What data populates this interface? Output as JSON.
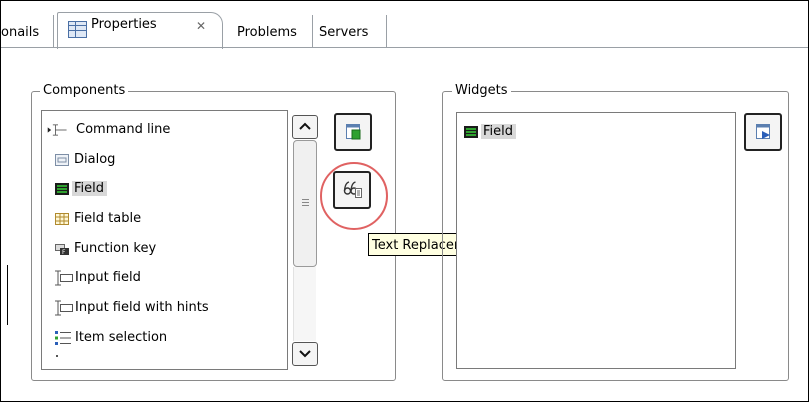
{
  "tabs": {
    "partial_left_label": "onails",
    "active_label": "Properties",
    "close_glyph": "✕",
    "problems_label": "Problems",
    "servers_label": "Servers"
  },
  "components": {
    "group_label": "Components",
    "items": [
      {
        "label": "Command line",
        "icon": "command-line-icon"
      },
      {
        "label": "Dialog",
        "icon": "dialog-icon"
      },
      {
        "label": "Field",
        "icon": "field-icon",
        "selected": true
      },
      {
        "label": "Field table",
        "icon": "field-table-icon"
      },
      {
        "label": "Function key",
        "icon": "function-key-icon"
      },
      {
        "label": "Input field",
        "icon": "input-field-icon"
      },
      {
        "label": "Input field with hints",
        "icon": "input-field-hints-icon"
      },
      {
        "label": "Item selection",
        "icon": "item-selection-icon"
      }
    ],
    "add_button_icon": "add-widget-icon",
    "text_replacement_button_icon": "text-replacement-icon"
  },
  "tooltip": {
    "text": "Text Replacement"
  },
  "widgets": {
    "group_label": "Widgets",
    "items": [
      {
        "label": "Field",
        "icon": "field-icon",
        "selected": true
      }
    ],
    "remove_button_icon": "remove-widget-icon"
  },
  "colors": {
    "selection_bg": "#d8d8d8",
    "tooltip_bg": "#ffffe1",
    "highlight_ring": "#e06262",
    "field_icon_green": "#2fa12f"
  }
}
